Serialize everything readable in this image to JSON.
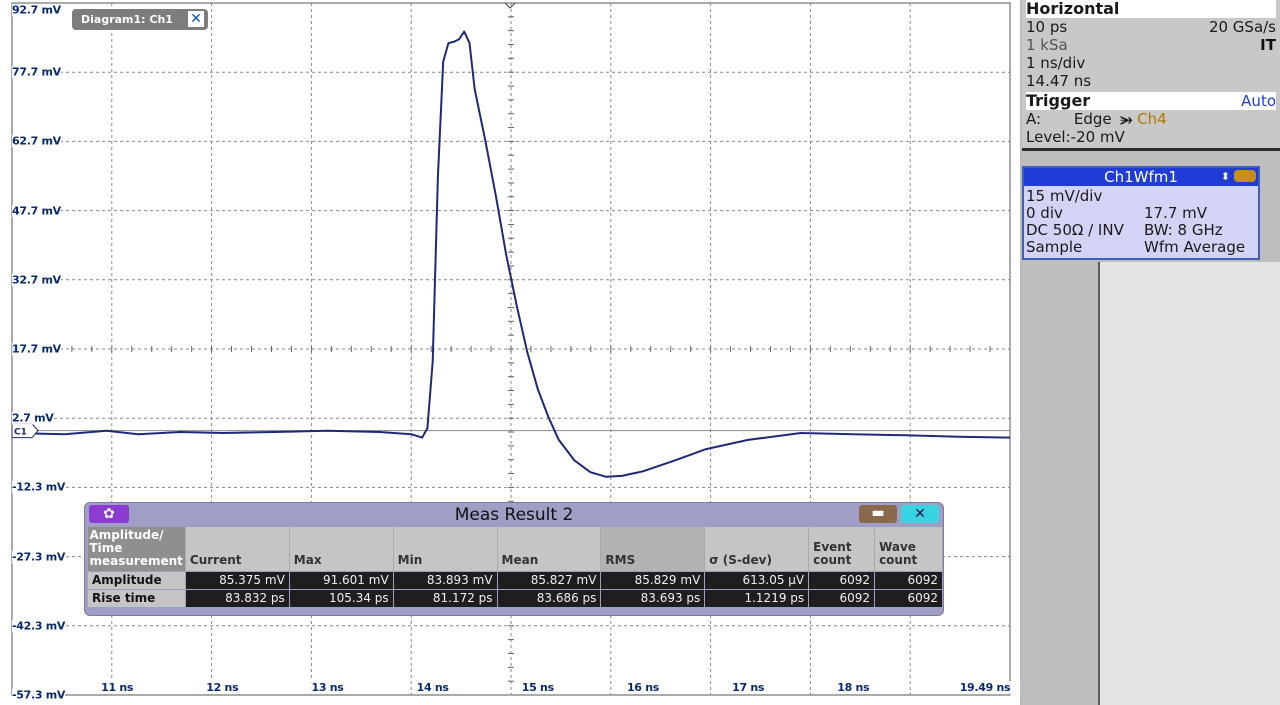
{
  "diagram": {
    "tab_label": "Diagram1: Ch1",
    "close_label": "✕"
  },
  "chart_data": {
    "type": "line",
    "title": "",
    "xlabel": "",
    "ylabel": "",
    "y_unit": "mV",
    "x_unit": "ns",
    "xlim": [
      10.0,
      19.49
    ],
    "ylim": [
      -57.3,
      92.7
    ],
    "y_ticks": [
      "92.7 mV",
      "77.7 mV",
      "62.7 mV",
      "47.7 mV",
      "32.7 mV",
      "17.7 mV",
      "2.7 mV",
      "-12.3 mV",
      "-27.3 mV",
      "-42.3 mV",
      "-57.3 mV"
    ],
    "x_ticks": [
      "11 ns",
      "12 ns",
      "13 ns",
      "14 ns",
      "15 ns",
      "16 ns",
      "17 ns",
      "18 ns",
      "19.49 ns"
    ],
    "grid": true,
    "channel_marker": "C1",
    "series": [
      {
        "color": "#1e2a78",
        "x": [
          10.0,
          10.5,
          10.9,
          11.2,
          11.6,
          12.0,
          12.5,
          13.0,
          13.5,
          13.8,
          13.9,
          13.95,
          14.0,
          14.05,
          14.1,
          14.15,
          14.2,
          14.25,
          14.3,
          14.35,
          14.4,
          14.5,
          14.6,
          14.7,
          14.8,
          14.9,
          15.0,
          15.1,
          15.2,
          15.35,
          15.5,
          15.65,
          15.8,
          16.0,
          16.3,
          16.6,
          17.0,
          17.5,
          18.0,
          18.5,
          19.0,
          19.49
        ],
        "y": [
          -0.5,
          -0.8,
          0.0,
          -0.8,
          -0.3,
          -0.5,
          -0.3,
          0.0,
          -0.3,
          -0.8,
          -1.5,
          0.5,
          15.0,
          55.0,
          80.0,
          84.0,
          84.3,
          84.8,
          86.5,
          84.0,
          74.0,
          63.0,
          51.0,
          38.0,
          27.0,
          17.0,
          9.0,
          3.0,
          -2.0,
          -6.5,
          -9.0,
          -10.0,
          -9.8,
          -8.8,
          -6.5,
          -4.0,
          -2.0,
          -0.5,
          -0.8,
          -1.0,
          -1.3,
          -1.5
        ]
      }
    ]
  },
  "horizontal": {
    "title": "Horizontal",
    "resolution": "10 ps",
    "sample_rate": "20 GSa/s",
    "record_length": "1 kSa",
    "mode": "IT",
    "time_scale": "1 ns/div",
    "position": "14.47 ns"
  },
  "trigger": {
    "title": "Trigger",
    "mode": "Auto",
    "slot": "A:",
    "type": "Edge",
    "slope_icon": "falling-edge-icon",
    "source": "Ch4",
    "level_label": "Level:",
    "level_value": "-20 mV"
  },
  "channel": {
    "name": "Ch1Wfm1",
    "scale": "15 mV/div",
    "position": "0 div",
    "offset": "17.7 mV",
    "coupling": "DC 50Ω / INV",
    "bandwidth": "BW: 8 GHz",
    "acq_mode": "Sample",
    "arith": "Wfm Average"
  },
  "meas": {
    "title": "Meas Result 2",
    "gear_label": "✿",
    "minimize_label": "▬",
    "close_label": "✕",
    "columns": [
      "Amplitude/ Time measurement",
      "Current",
      "Max",
      "Min",
      "Mean",
      "RMS",
      "σ (S-dev)",
      "Event count",
      "Wave count"
    ],
    "rows": [
      {
        "label": "Amplitude",
        "values": [
          "85.375 mV",
          "91.601 mV",
          "83.893 mV",
          "85.827 mV",
          "85.829 mV",
          "613.05 µV",
          "6092",
          "6092"
        ]
      },
      {
        "label": "Rise time",
        "values": [
          "83.832 ps",
          "105.34 ps",
          "81.172 ps",
          "83.686 ps",
          "83.693 ps",
          "1.1219 ps",
          "6092",
          "6092"
        ]
      }
    ]
  },
  "colors": {
    "trace": "#1e2a78",
    "grid": "#8a8a8a",
    "channel_header": "#1f3dd6",
    "channel_bg": "#d3d3f5",
    "meas_bg": "#9f9fc6"
  }
}
